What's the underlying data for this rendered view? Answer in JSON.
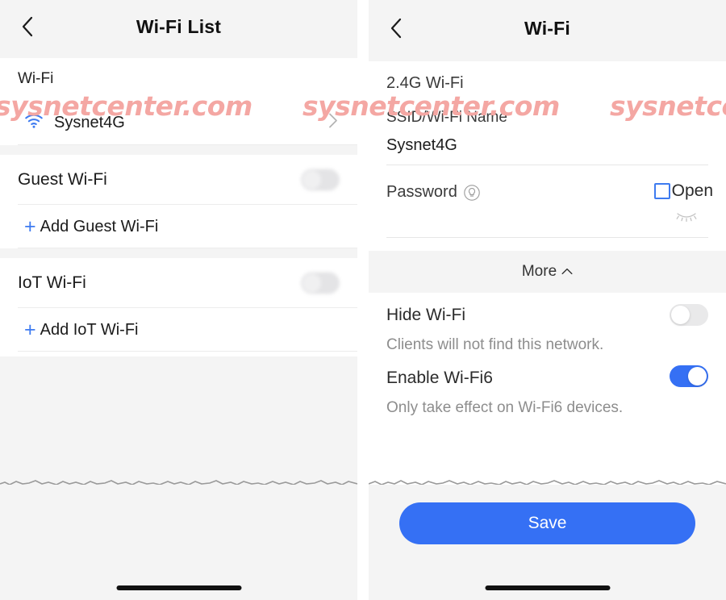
{
  "watermark": {
    "text": "sysnetcenter.com",
    "color": "#f4a7a3"
  },
  "theme": {
    "accent_blue": "#3570f4",
    "link_blue": "#3e7bf0",
    "panel_bg": "#ffffff",
    "section_bg": "#f4f4f4",
    "muted_text": "#8d8d8d"
  },
  "left_screen": {
    "navbar": {
      "title": "Wi-Fi List",
      "back_icon": "chevron-left-icon"
    },
    "sections": [
      {
        "header": "Wi-Fi",
        "networks": [
          {
            "icon": "wifi-signal-icon",
            "name": "Sysnet4G",
            "chevron": "chevron-right-icon"
          }
        ]
      },
      {
        "title": "Guest Wi-Fi",
        "toggle": {
          "state": "off",
          "label": "Guest Wi-Fi toggle"
        },
        "add_label": "Add Guest Wi-Fi",
        "add_icon": "plus-icon"
      },
      {
        "title": "IoT Wi-Fi",
        "toggle": {
          "state": "off",
          "label": "IoT Wi-Fi toggle"
        },
        "add_label": "Add IoT Wi-Fi",
        "add_icon": "plus-icon"
      }
    ]
  },
  "right_screen": {
    "navbar": {
      "title": "Wi-Fi",
      "back_icon": "chevron-left-icon"
    },
    "band_label": "2.4G Wi-Fi",
    "ssid_field": {
      "label": "SSID/Wi-Fi Name",
      "value": "Sysnet4G"
    },
    "password_field": {
      "label": "Password",
      "hint_icon": "lightbulb-icon",
      "value": "",
      "reveal_icon": "eye-closed-icon",
      "open_checkbox": {
        "label": "Open",
        "checked": false
      }
    },
    "more": {
      "label": "More",
      "icon": "chevron-up-icon",
      "expanded": true
    },
    "options": [
      {
        "title": "Hide Wi-Fi",
        "description": "Clients will not find this network.",
        "toggle": {
          "state": "off"
        }
      },
      {
        "title": "Enable Wi-Fi6",
        "description": "Only take effect on Wi-Fi6 devices.",
        "toggle": {
          "state": "on"
        }
      }
    ],
    "save_button": {
      "label": "Save"
    }
  }
}
